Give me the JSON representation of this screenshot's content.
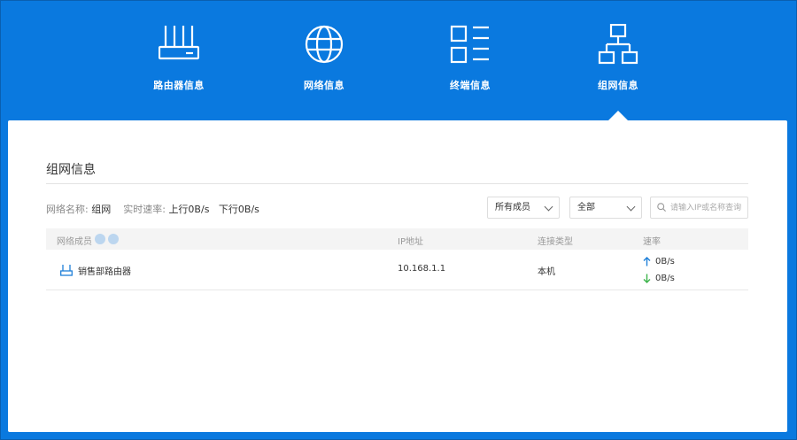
{
  "nav": {
    "items": [
      {
        "label": "路由器信息",
        "icon": "router-icon"
      },
      {
        "label": "网络信息",
        "icon": "globe-icon"
      },
      {
        "label": "终端信息",
        "icon": "device-list-icon"
      },
      {
        "label": "组网信息",
        "icon": "network-topology-icon"
      }
    ],
    "active_index": 3
  },
  "page": {
    "title": "组网信息",
    "network_name_label": "网络名称:",
    "network_name": "组网",
    "realtime_label": "实时速率:",
    "upload": "上行0B/s",
    "download": "下行0B/s"
  },
  "filters": {
    "members": "所有成员",
    "scope": "全部",
    "search_placeholder": "请输入IP或名称查询"
  },
  "table": {
    "headers": [
      "网络成员",
      "IP地址",
      "连接类型",
      "速率"
    ],
    "rows": [
      {
        "name": "销售部路由器",
        "ip": "10.168.1.1",
        "type": "本机",
        "up": "0B/s",
        "down": "0B/s"
      }
    ]
  },
  "colors": {
    "accent": "#0a79df",
    "up_arrow": "#1e7fd8",
    "down_arrow": "#3cb34a"
  }
}
